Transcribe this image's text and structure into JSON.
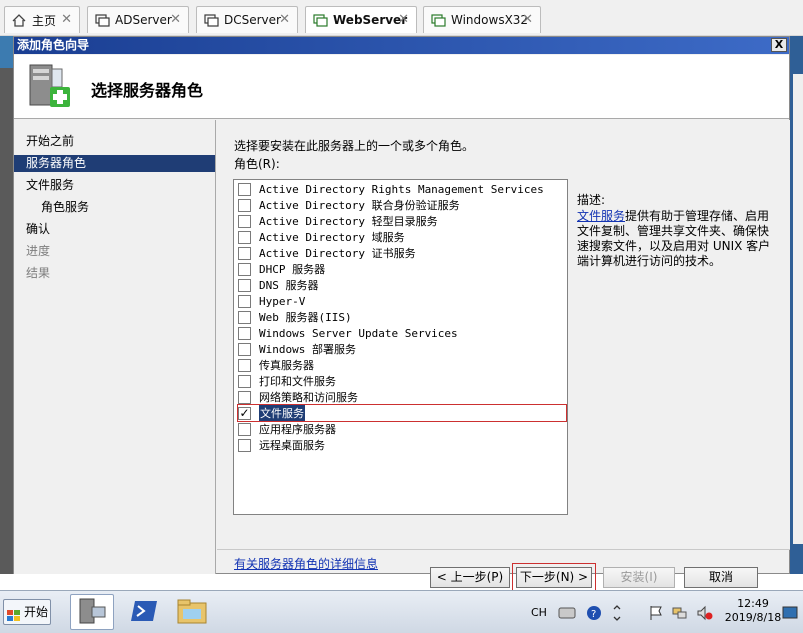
{
  "tabs": [
    {
      "label": "主页",
      "icon": "home-icon"
    },
    {
      "label": "ADServer",
      "icon": "vm-icon"
    },
    {
      "label": "DCServer",
      "icon": "vm-icon"
    },
    {
      "label": "WebServer",
      "icon": "vm-icon"
    },
    {
      "label": "WindowsX32",
      "icon": "vm-icon"
    }
  ],
  "wizard": {
    "title": "添加角色向导",
    "close_label": "X",
    "header_title": "选择服务器角色"
  },
  "nav": {
    "steps": [
      {
        "label": "开始之前"
      },
      {
        "label": "服务器角色"
      },
      {
        "label": "文件服务"
      },
      {
        "label": "角色服务"
      },
      {
        "label": "确认"
      },
      {
        "label": "进度"
      },
      {
        "label": "结果"
      }
    ]
  },
  "content": {
    "instruction": "选择要安装在此服务器上的一个或多个角色。",
    "roles_label": "角色(R):",
    "roles": [
      {
        "label": "Active Directory Rights Management Services",
        "checked": false
      },
      {
        "label": "Active Directory 联合身份验证服务",
        "checked": false
      },
      {
        "label": "Active Directory 轻型目录服务",
        "checked": false
      },
      {
        "label": "Active Directory 域服务",
        "checked": false
      },
      {
        "label": "Active Directory 证书服务",
        "checked": false
      },
      {
        "label": "DHCP 服务器",
        "checked": false
      },
      {
        "label": "DNS 服务器",
        "checked": false
      },
      {
        "label": "Hyper-V",
        "checked": false
      },
      {
        "label": "Web 服务器(IIS)",
        "checked": false
      },
      {
        "label": "Windows Server Update Services",
        "checked": false
      },
      {
        "label": "Windows 部署服务",
        "checked": false
      },
      {
        "label": "传真服务器",
        "checked": false
      },
      {
        "label": "打印和文件服务",
        "checked": false
      },
      {
        "label": "网络策略和访问服务",
        "checked": false
      },
      {
        "label": "文件服务",
        "checked": true
      },
      {
        "label": "应用程序服务器",
        "checked": false
      },
      {
        "label": "远程桌面服务",
        "checked": false
      }
    ],
    "more_info_link": "有关服务器角色的详细信息",
    "description_label": "描述:",
    "description_link": "文件服务",
    "description_text": "提供有助于管理存储、启用文件复制、管理共享文件夹、确保快速搜索文件，以及启用对 UNIX 客户端计算机进行访问的技术。"
  },
  "buttons": {
    "back": "< 上一步(P)",
    "next": "下一步(N) >",
    "install": "安装(I)",
    "cancel": "取消"
  },
  "taskbar": {
    "start_label": "开始",
    "language": "CH",
    "time": "12:49",
    "date": "2019/8/18"
  },
  "colors": {
    "title_bar": "#1a3e92",
    "nav_selected": "#1f3d75",
    "link": "#1233b3",
    "highlight_box": "#cc3030"
  }
}
